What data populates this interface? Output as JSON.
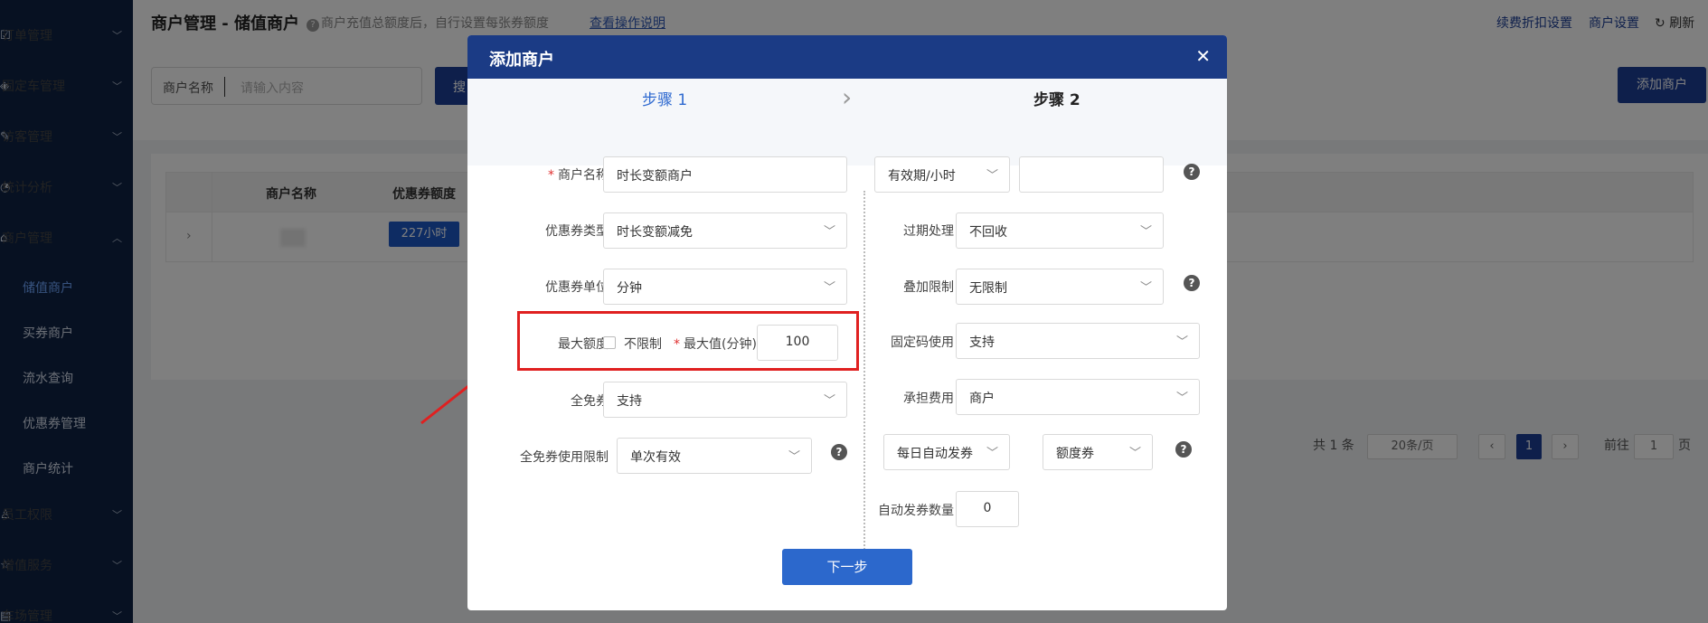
{
  "sidebar": {
    "items": [
      {
        "label": "订单管理",
        "icon": "order-icon"
      },
      {
        "label": "固定车管理",
        "icon": "car-icon"
      },
      {
        "label": "访客管理",
        "icon": "visitor-icon"
      },
      {
        "label": "统计分析",
        "icon": "chart-icon"
      },
      {
        "label": "商户管理",
        "icon": "merchant-icon"
      },
      {
        "label": "员工权限",
        "icon": "staff-icon"
      },
      {
        "label": "增值服务",
        "icon": "star-icon"
      },
      {
        "label": "车场管理",
        "icon": "parking-icon"
      }
    ],
    "sub_items": [
      "储值商户",
      "买券商户",
      "流水查询",
      "优惠券管理",
      "商户统计"
    ]
  },
  "header": {
    "title": "商户管理 - 储值商户",
    "tip": "商户充值总额度后，自行设置每张券额度",
    "tip_link": "查看操作说明",
    "links": [
      "续费折扣设置",
      "商户设置",
      "刷新"
    ]
  },
  "filter": {
    "label": "商户名称",
    "placeholder": "请输入内容",
    "search_label": "搜",
    "add_label": "添加商户"
  },
  "table": {
    "headers": [
      "商户名称",
      "优惠券额度"
    ],
    "row_tag": "227小时"
  },
  "pagination": {
    "total": "共 1 条",
    "page_size": "20条/页",
    "current": "1",
    "goto_label": "前往",
    "goto_value": "1",
    "page_unit": "页"
  },
  "modal": {
    "title": "添加商户",
    "step1": "步骤 1",
    "step2": "步骤 2",
    "left": {
      "merchant_name_label": "商户名称",
      "merchant_name_value": "时长变额商户",
      "coupon_type_label": "优惠券类型",
      "coupon_type_value": "时长变额减免",
      "coupon_unit_label": "优惠券单位",
      "coupon_unit_value": "分钟",
      "max_amount_label": "最大额度",
      "unlimited_label": "不限制",
      "max_value_label": "最大值(分钟)",
      "max_value": "100",
      "free_coupon_label": "全免券",
      "free_coupon_value": "支持",
      "free_limit_label": "全免券使用限制",
      "free_limit_value": "单次有效"
    },
    "right": {
      "validity_select": "有效期/小时",
      "validity_value": "",
      "expire_label": "过期处理",
      "expire_value": "不回收",
      "stack_label": "叠加限制",
      "stack_value": "无限制",
      "fixed_code_label": "固定码使用",
      "fixed_code_value": "支持",
      "fee_label": "承担费用",
      "fee_value": "商户",
      "daily_auto_value": "每日自动发券",
      "coupon_kind_value": "额度券",
      "auto_count_label": "自动发券数量",
      "auto_count_value": "0"
    },
    "next_label": "下一步"
  },
  "colors": {
    "sidebar_bg": "#0f2345",
    "primary": "#1d3f97",
    "modal_header": "#1b3b85",
    "highlight": "#e02020"
  }
}
